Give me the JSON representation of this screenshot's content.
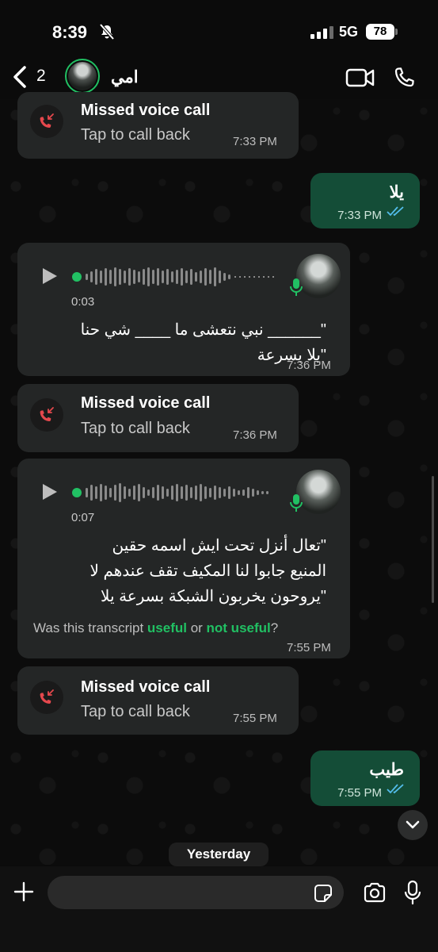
{
  "status_bar": {
    "time": "8:39",
    "network": "5G",
    "battery": "78"
  },
  "header": {
    "back_count": "2",
    "contact_name": "امي"
  },
  "messages": {
    "missed_1": {
      "title": "Missed voice call",
      "subtitle": "Tap to call back",
      "time": "7:33 PM"
    },
    "out_1": {
      "text": "يلا",
      "time": "7:33 PM"
    },
    "voice_1": {
      "duration": "0:03",
      "transcript_line1": "\"______ نبي نتعشى ما ____ شي حنا",
      "transcript_line2": "\"يلا بسرعة",
      "time": "7:36 PM"
    },
    "missed_2": {
      "title": "Missed voice call",
      "subtitle": "Tap to call back",
      "time": "7:36 PM"
    },
    "voice_2": {
      "duration": "0:07",
      "transcript_line1": "\"تعال أنزل تحت ايش اسمه حقين",
      "transcript_line2": "المنيع جابوا لنا المكيف تقف عندهم لا",
      "transcript_line3": "\"يروحون يخربون الشبكة بسرعة يلا",
      "feedback_prefix": "Was this transcript ",
      "feedback_useful": "useful",
      "feedback_or": " or ",
      "feedback_not_useful": "not useful",
      "feedback_suffix": "?",
      "time": "7:55 PM"
    },
    "missed_3": {
      "title": "Missed voice call",
      "subtitle": "Tap to call back",
      "time": "7:55 PM"
    },
    "out_2": {
      "text": "طيب",
      "time": "7:55 PM"
    }
  },
  "date_chip": "Yesterday",
  "input": {
    "placeholder": ""
  },
  "colors": {
    "accent": "#21c063",
    "outgoing_bubble": "#144d37",
    "incoming_bubble": "#242626",
    "missed_red": "#e5484d",
    "read_ticks": "#53bdeb"
  }
}
